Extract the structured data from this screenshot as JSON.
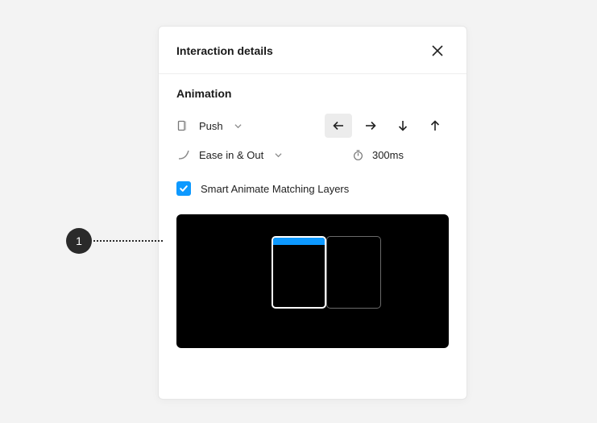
{
  "panel": {
    "title": "Interaction details",
    "section_title": "Animation",
    "transition_label": "Push",
    "easing_label": "Ease in & Out",
    "duration_label": "300ms",
    "smart_animate_label": "Smart Animate Matching Layers",
    "smart_animate_checked": true,
    "selected_direction": "left"
  },
  "annotation": {
    "index": "1"
  }
}
